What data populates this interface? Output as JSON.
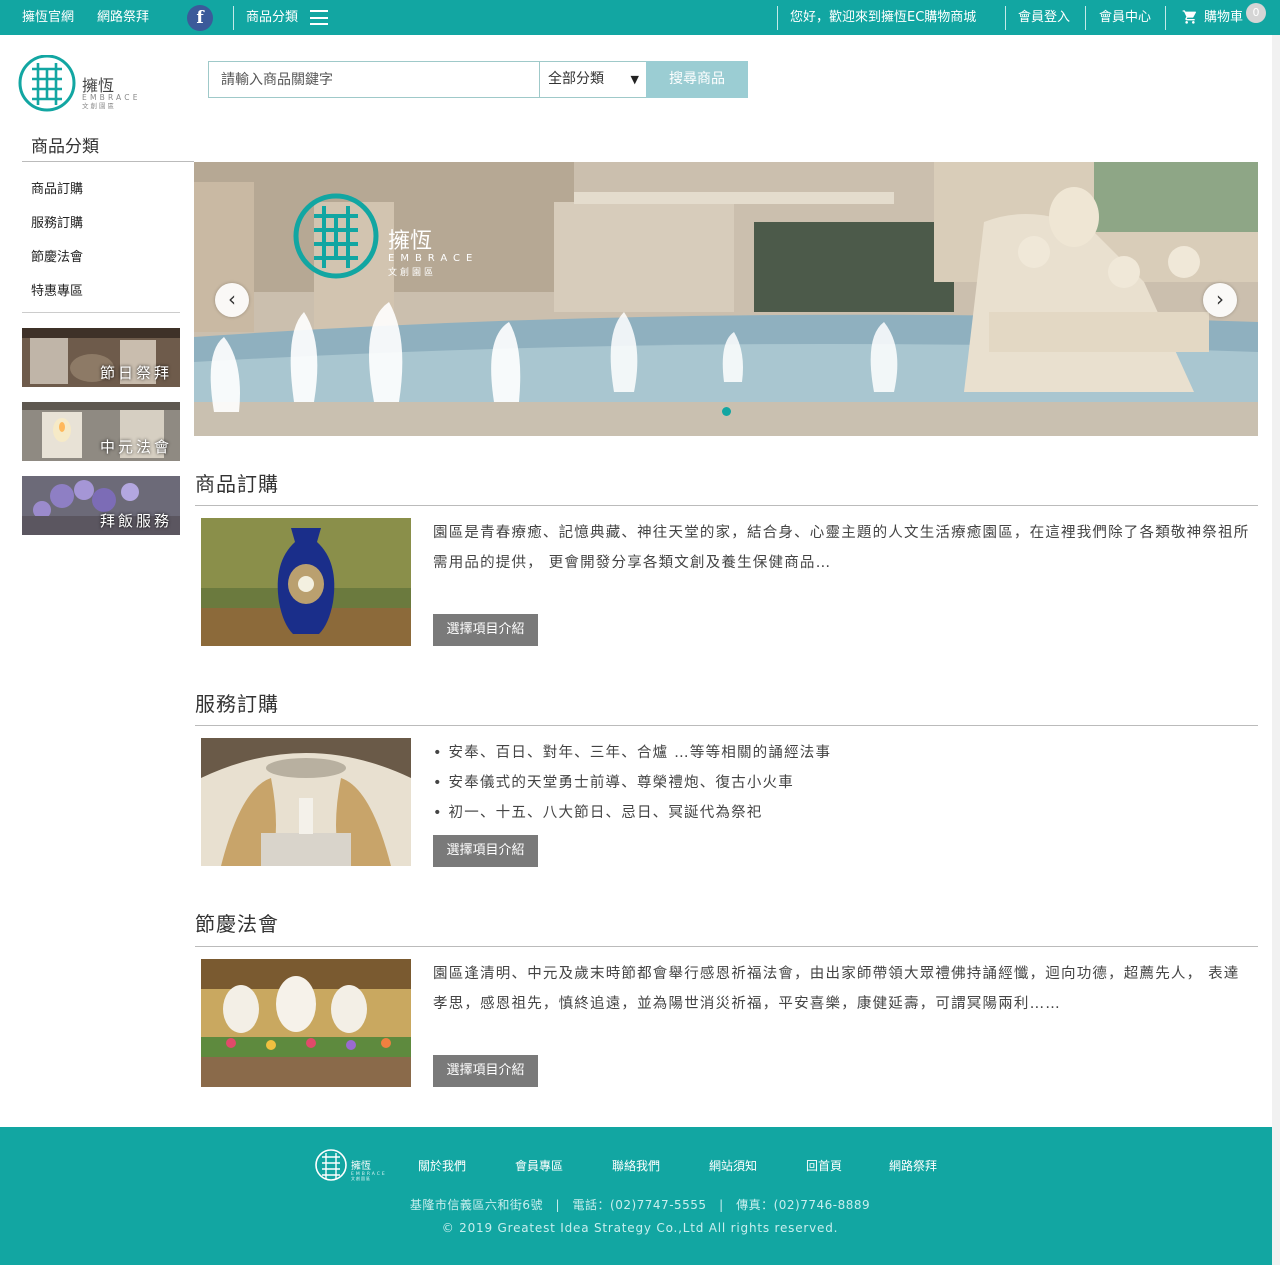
{
  "topbar": {
    "official_site": "擁恆官網",
    "online_worship": "網路祭拜",
    "facebook_glyph": "f",
    "categories": "商品分類",
    "welcome": "您好，歡迎來到擁恆EC購物商城",
    "login": "會員登入",
    "member_center": "會員中心",
    "cart": "購物車",
    "cart_count": "0"
  },
  "logo": {
    "brand_cn": "擁恆",
    "brand_en": "EMBRACE",
    "tagline": "文創園區"
  },
  "search": {
    "placeholder": "請輸入商品關鍵字",
    "category": "全部分類",
    "button": "搜尋商品"
  },
  "sidebar": {
    "title": "商品分類",
    "items": [
      "商品訂購",
      "服務訂購",
      "節慶法會",
      "特惠專區"
    ],
    "tiles": [
      "節日祭拜",
      "中元法會",
      "拜飯服務"
    ]
  },
  "sections": [
    {
      "title": "商品訂購",
      "desc": "園區是青春療癒、記憶典藏、神往天堂的家，結合身、心靈主題的人文生活療癒園區，在這裡我們除了各類敬神祭祖所需用品的提供， 更會開發分享各類文創及養生保健商品…",
      "button": "選擇項目介紹"
    },
    {
      "title": "服務訂購",
      "bullets": [
        "• 安奉、百日、對年、三年、合爐 …等等相關的誦經法事",
        "• 安奉儀式的天堂勇士前導、尊榮禮炮、復古小火車",
        "• 初一、十五、八大節日、忌日、冥誕代為祭祀"
      ],
      "button": "選擇項目介紹"
    },
    {
      "title": "節慶法會",
      "desc": "園區逢清明、中元及歲末時節都會舉行感恩祈福法會，由出家師帶領大眾禮佛持誦經懺，迴向功德，超薦先人， 表達孝思，感恩祖先，慎終追遠，並為陽世消災祈福，平安喜樂，康健延壽，可謂冥陽兩利……",
      "button": "選擇項目介紹"
    }
  ],
  "footer": {
    "links": [
      "關於我們",
      "會員專區",
      "聯絡我們",
      "網站須知",
      "回首頁",
      "網路祭拜"
    ],
    "address": "基隆市信義區六和街6號　|　電話：(02)7747-5555　|　傳真：(02)7746-8889",
    "copyright": "© 2019 Greatest Idea Strategy Co.,Ltd All rights reserved."
  },
  "colors": {
    "brand": "#12a6a2",
    "search_button": "#9bcdd3",
    "more_button": "#7a7a7a"
  }
}
